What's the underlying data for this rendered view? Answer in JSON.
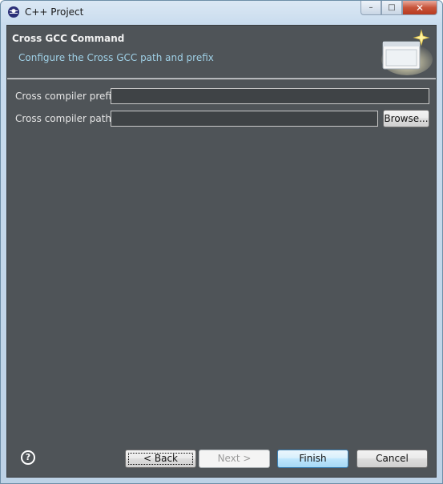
{
  "window": {
    "title": "C++ Project",
    "controls": {
      "minimize": "–",
      "maximize": "□",
      "close": "✕"
    }
  },
  "header": {
    "title": "Cross GCC Command",
    "description": "Configure the Cross GCC path and prefix",
    "banner_icon": "wizard-banner-icon"
  },
  "form": {
    "prefix_label": "Cross compiler prefix:",
    "prefix_value": "",
    "path_label": "Cross compiler path:",
    "path_value": "",
    "browse_label": "Browse..."
  },
  "footer": {
    "help_glyph": "?",
    "back_label": "< Back",
    "next_label": "Next >",
    "finish_label": "Finish",
    "cancel_label": "Cancel"
  },
  "colors": {
    "client_background": "#4f5458",
    "description_text": "#9fd0e6",
    "frame": "#c9dcee"
  }
}
